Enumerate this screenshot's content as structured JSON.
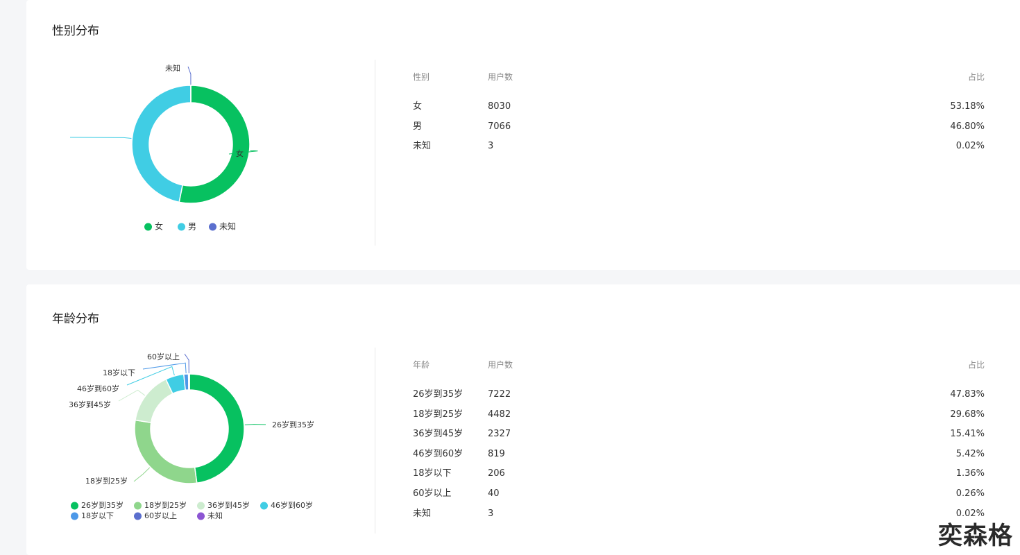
{
  "gender": {
    "title": "性别分布",
    "headers": [
      "性别",
      "用户数",
      "占比"
    ],
    "rows": [
      {
        "label": "女",
        "count": "8030",
        "pct": "53.18%"
      },
      {
        "label": "男",
        "count": "7066",
        "pct": "46.80%"
      },
      {
        "label": "未知",
        "count": "3",
        "pct": "0.02%"
      }
    ]
  },
  "age": {
    "title": "年龄分布",
    "headers": [
      "年龄",
      "用户数",
      "占比"
    ],
    "rows": [
      {
        "label": "26岁到35岁",
        "count": "7222",
        "pct": "47.83%"
      },
      {
        "label": "18岁到25岁",
        "count": "4482",
        "pct": "29.68%"
      },
      {
        "label": "36岁到45岁",
        "count": "2327",
        "pct": "15.41%"
      },
      {
        "label": "46岁到60岁",
        "count": "819",
        "pct": "5.42%"
      },
      {
        "label": "18岁以下",
        "count": "206",
        "pct": "1.36%"
      },
      {
        "label": "60岁以上",
        "count": "40",
        "pct": "0.26%"
      },
      {
        "label": "未知",
        "count": "3",
        "pct": "0.02%"
      }
    ]
  },
  "chart_data": [
    {
      "type": "pie",
      "title": "性别分布",
      "categories": [
        "女",
        "男",
        "未知"
      ],
      "values": [
        8030,
        7066,
        3
      ],
      "colors": [
        "#07c160",
        "#40cde4",
        "#5b6fce"
      ],
      "legend": "bottom"
    },
    {
      "type": "pie",
      "title": "年龄分布",
      "categories": [
        "26岁到35岁",
        "18岁到25岁",
        "36岁到45岁",
        "46岁到60岁",
        "18岁以下",
        "60岁以上",
        "未知"
      ],
      "values": [
        7222,
        4482,
        2327,
        819,
        206,
        40,
        3
      ],
      "colors": [
        "#07c160",
        "#8fd68c",
        "#cdeccf",
        "#40cde4",
        "#4c98e8",
        "#5b6fce",
        "#8c55d3"
      ],
      "legend": "bottom"
    }
  ],
  "watermark": "奕森格"
}
